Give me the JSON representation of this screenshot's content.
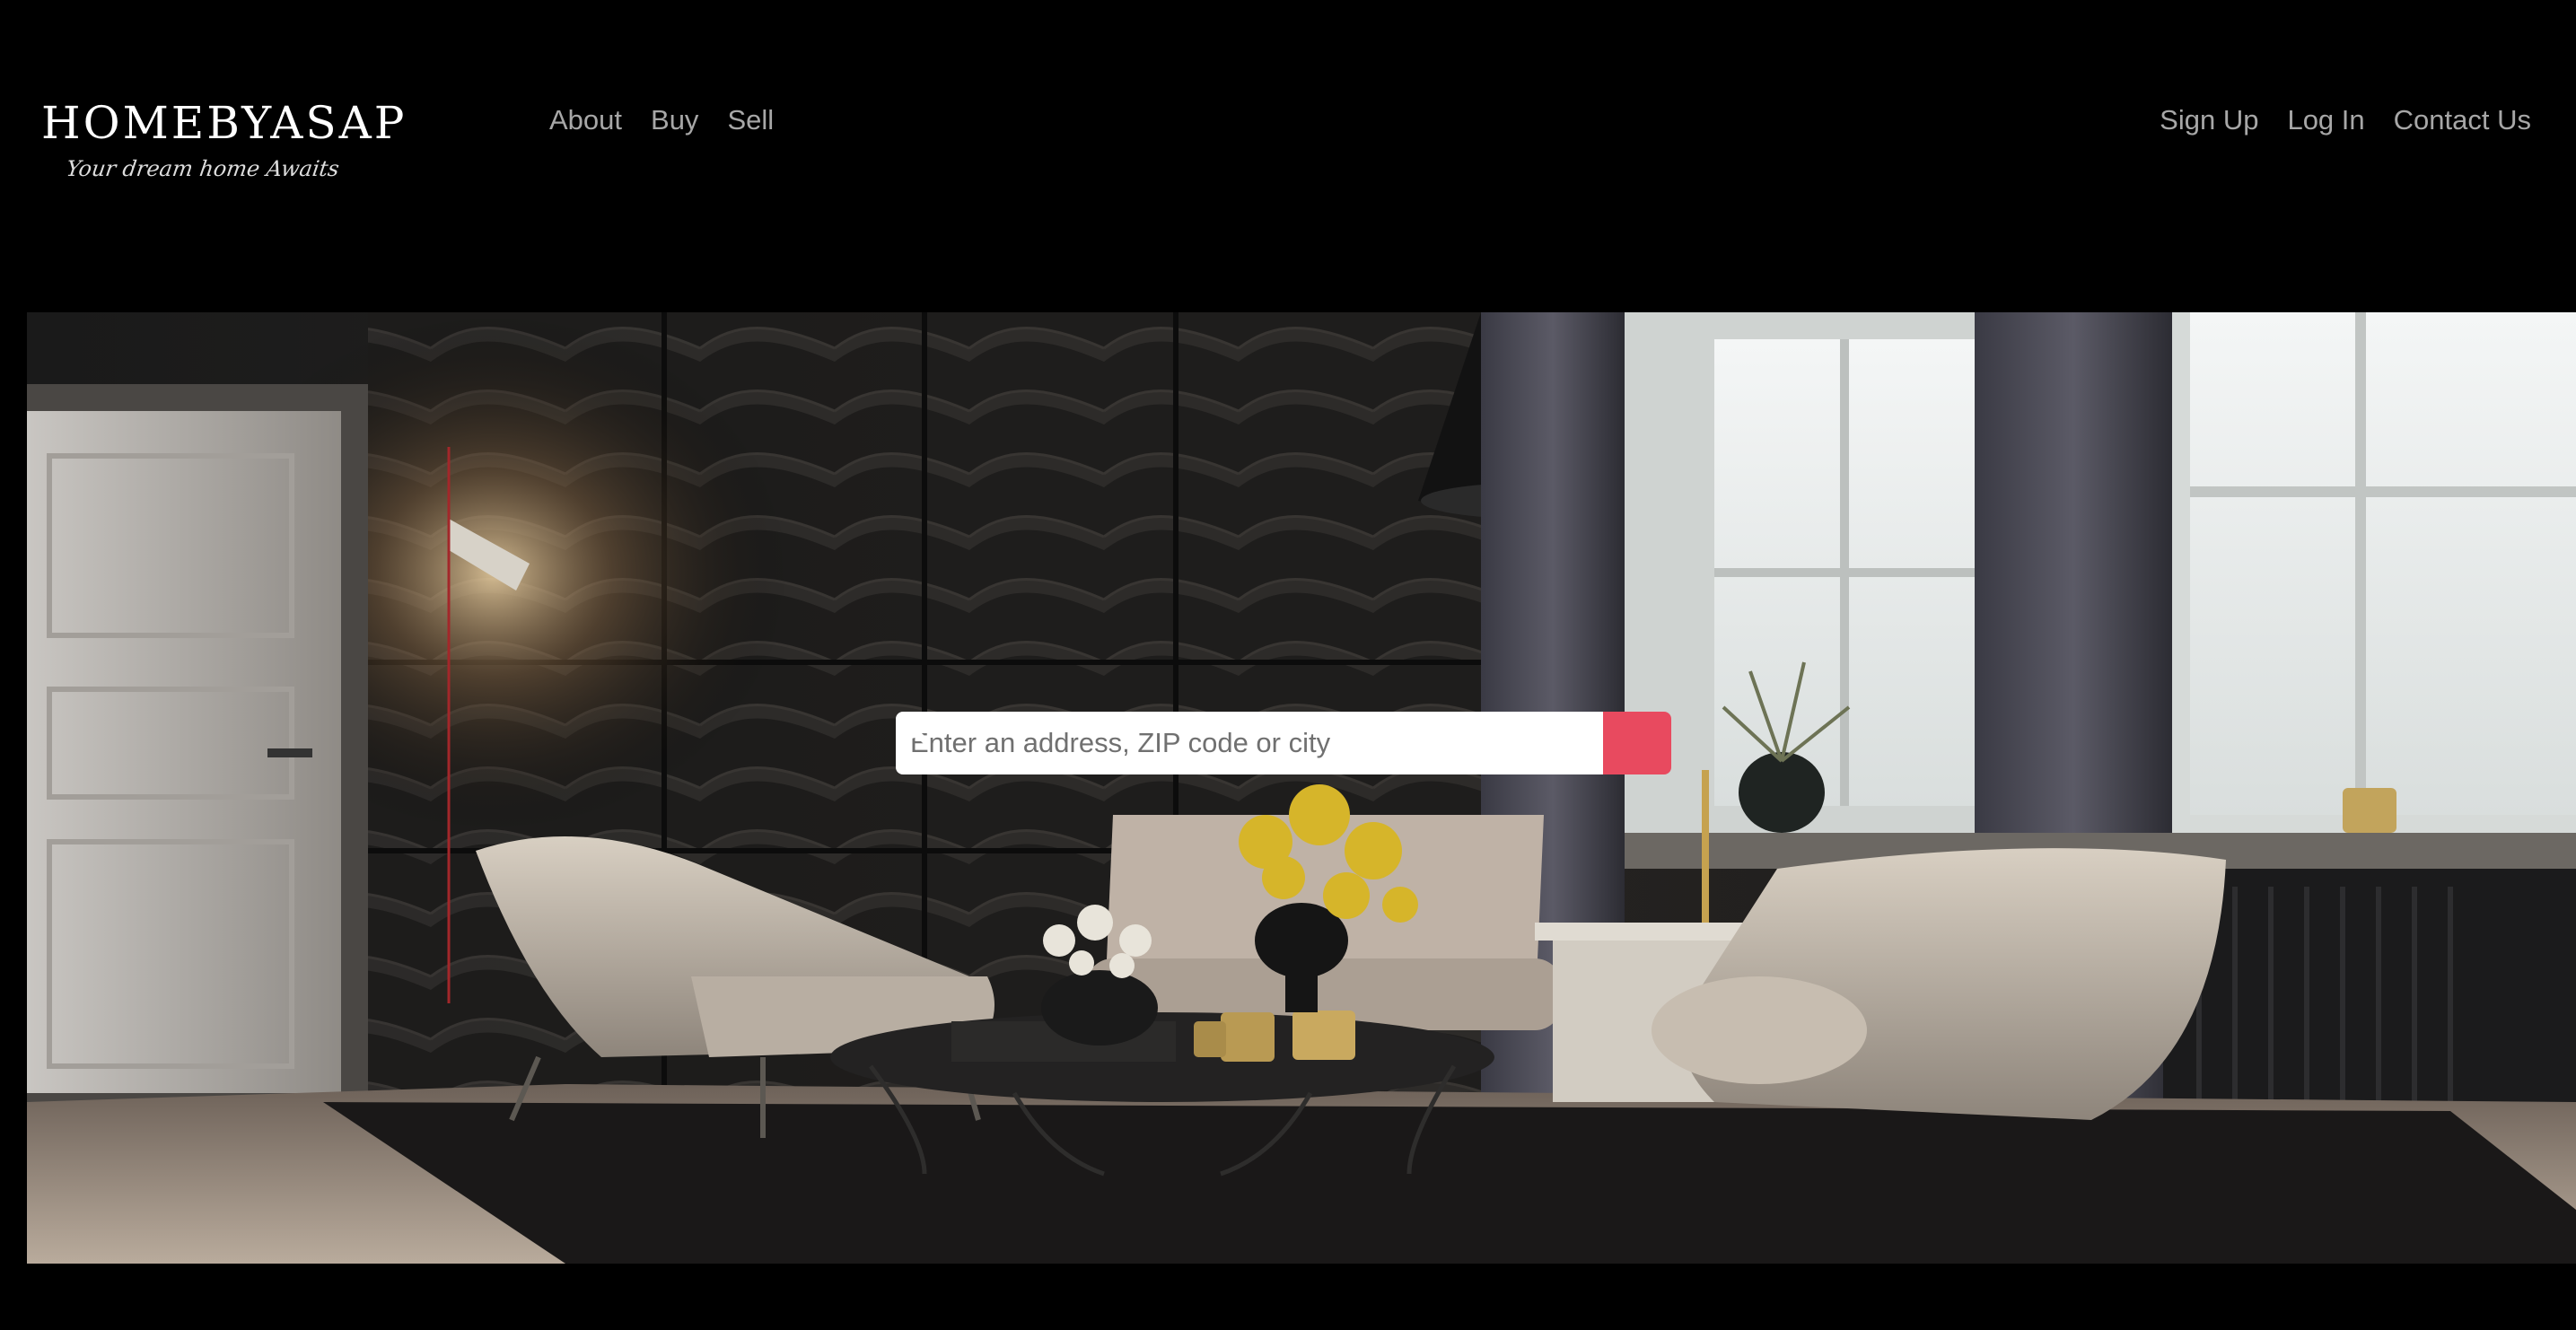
{
  "header": {
    "logo_text": "HOMEBYASAP",
    "logo_tagline": "Your dream home Awaits",
    "nav_left": [
      "About",
      "Buy",
      "Sell"
    ],
    "nav_right": [
      "Sign Up",
      "Log In",
      "Contact Us"
    ]
  },
  "search": {
    "placeholder": "Enter an address, ZIP code or city",
    "value": "",
    "button_icon": "search-icon"
  },
  "colors": {
    "background": "#000000",
    "nav_text": "#a7a7a7",
    "search_button": "#e84a5f"
  }
}
